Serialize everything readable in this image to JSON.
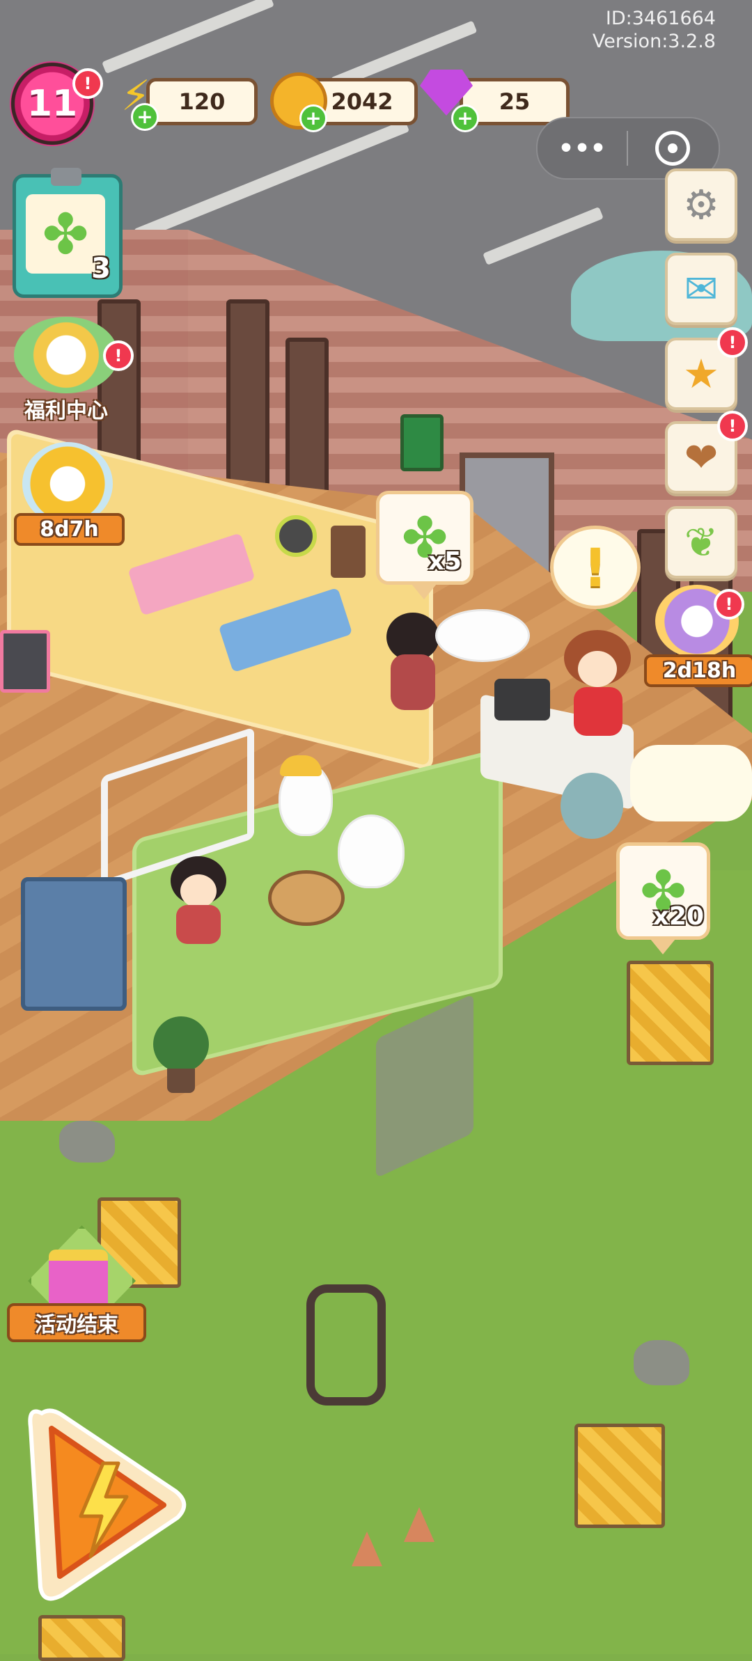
{
  "hud": {
    "level": "11",
    "energy": "120",
    "coins": "2042",
    "gems": "25",
    "id_label": "ID:3461664",
    "version_label": "Version:3.2.8"
  },
  "quest": {
    "count": "3"
  },
  "left_buttons": {
    "welfare_label": "福利中心",
    "event_timer": "8d7h",
    "activity_label": "活动结束"
  },
  "right_buttons": {
    "gift_timer": "2d18h"
  },
  "bubbles": {
    "shop_clover": "x5",
    "outside_clover": "x20"
  },
  "icons": {
    "energy": "lightning-icon",
    "coin": "coin-icon",
    "gem": "gem-icon",
    "settings": "gear-icon",
    "mail": "mail-icon",
    "achievement": "medal-icon",
    "book": "book-icon",
    "album": "album-icon",
    "boost": "lightning-play-icon"
  },
  "colors": {
    "accent_pink": "#ff4f9a",
    "resource_border": "#7a5233",
    "clover_green": "#6cc447",
    "notification_red": "#f0384f"
  }
}
